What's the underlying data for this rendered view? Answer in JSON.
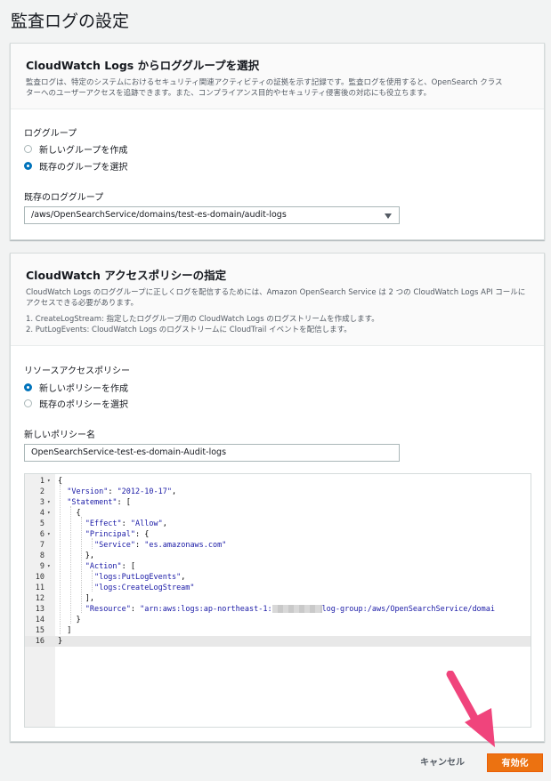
{
  "page": {
    "title": "監査ログの設定"
  },
  "log_group_panel": {
    "title": "CloudWatch Logs からロググループを選択",
    "desc_1": "監査ログは、特定のシステムにおけるセキュリティ関連アクティビティの証拠を示す記録です。監査ログを使用すると、OpenSearch クラス",
    "desc_2": "ターへのユーザーアクセスを追跡できます。また、コンプライアンス目的やセキュリティ侵害後の対応にも役立ちます。",
    "group_label": "ロググループ",
    "options": [
      {
        "label": "新しいグループを作成",
        "selected": false
      },
      {
        "label": "既存のグループを選択",
        "selected": true
      }
    ],
    "existing_label": "既存のロググループ",
    "existing_value": "/aws/OpenSearchService/domains/test-es-domain/audit-logs"
  },
  "policy_panel": {
    "title": "CloudWatch アクセスポリシーの指定",
    "desc_1": "CloudWatch Logs のロググループに正しくログを配信するためには、Amazon OpenSearch Service は 2 つの CloudWatch Logs API コールに",
    "desc_2": "アクセスできる必要があります。",
    "item_1": "1. CreateLogStream: 指定したロググループ用の CloudWatch Logs のログストリームを作成します。",
    "item_2": "2. PutLogEvents: CloudWatch Logs のログストリームに CloudTrail イベントを配信します。",
    "policy_label": "リソースアクセスポリシー",
    "options": [
      {
        "label": "新しいポリシーを作成",
        "selected": true
      },
      {
        "label": "既存のポリシーを選択",
        "selected": false
      }
    ],
    "name_label": "新しいポリシー名",
    "name_value": "OpenSearchService-test-es-domain-Audit-logs"
  },
  "editor": {
    "lines": [
      {
        "n": "1",
        "fold": true,
        "code": "{"
      },
      {
        "n": "2",
        "fold": false,
        "code": "  \"Version\": \"2012-10-17\","
      },
      {
        "n": "3",
        "fold": true,
        "code": "  \"Statement\": ["
      },
      {
        "n": "4",
        "fold": true,
        "code": "    {"
      },
      {
        "n": "5",
        "fold": false,
        "code": "      \"Effect\": \"Allow\","
      },
      {
        "n": "6",
        "fold": true,
        "code": "      \"Principal\": {"
      },
      {
        "n": "7",
        "fold": false,
        "code": "        \"Service\": \"es.amazonaws.com\""
      },
      {
        "n": "8",
        "fold": false,
        "code": "      },"
      },
      {
        "n": "9",
        "fold": true,
        "code": "      \"Action\": ["
      },
      {
        "n": "10",
        "fold": false,
        "code": "        \"logs:PutLogEvents\","
      },
      {
        "n": "11",
        "fold": false,
        "code": "        \"logs:CreateLogStream\""
      },
      {
        "n": "12",
        "fold": false,
        "code": "      ],"
      },
      {
        "n": "13",
        "fold": false,
        "code": "      \"Resource\": \"arn:aws:logs:ap-northeast-1:"
      },
      {
        "n": "14",
        "fold": false,
        "code": "    }"
      },
      {
        "n": "15",
        "fold": false,
        "code": "  ]"
      },
      {
        "n": "16",
        "fold": false,
        "code": "}"
      }
    ],
    "resource_tail": "log-group:/aws/OpenSearchService/domai"
  },
  "footer": {
    "cancel_label": "キャンセル",
    "enable_label": "有効化"
  },
  "colors": {
    "accent": "#ec7211",
    "radio_selected": "#0073bb",
    "arrow": "#f0447c"
  }
}
